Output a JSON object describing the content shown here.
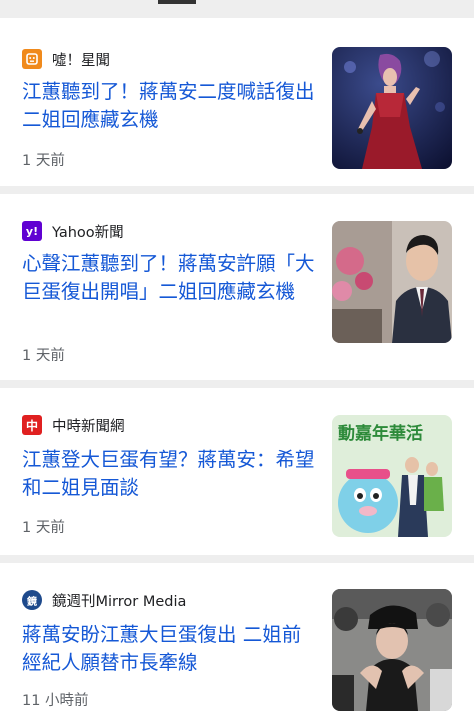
{
  "articles": [
    {
      "source": "噓！星聞",
      "headline": "江蕙聽到了！蔣萬安二度喊話復出 二姐回應藏玄機",
      "time": "1 天前",
      "logo_color": "#f08a1c"
    },
    {
      "source": "Yahoo新聞",
      "headline": "心聲江蕙聽到了！蔣萬安許願「大巨蛋復出開唱」二姐回應藏玄機",
      "time": "1 天前",
      "logo_color": "#6001d2",
      "logo_glyph": "y!"
    },
    {
      "source": "中時新聞網",
      "headline": "江蕙登大巨蛋有望？蔣萬安：希望和二姐見面談",
      "time": "1 天前",
      "logo_color": "#e02020",
      "logo_glyph": "中"
    },
    {
      "source": "鏡週刊Mirror Media",
      "headline": "蔣萬安盼江蕙大巨蛋復出 二姐前經紀人願替市長牽線",
      "time": "11 小時前",
      "logo_color": "#1e4a8c",
      "logo_glyph": "鏡"
    }
  ],
  "thumb3_banner_text": "動嘉年華活"
}
